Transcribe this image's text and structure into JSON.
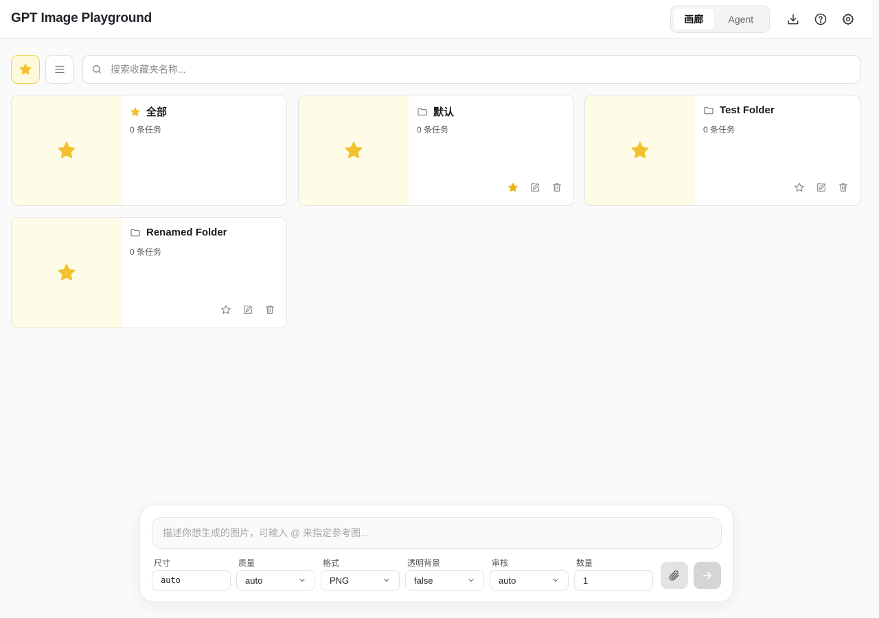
{
  "header": {
    "title": "GPT Image Playground",
    "tabs": [
      {
        "label": "画廊",
        "active": true
      },
      {
        "label": "Agent",
        "active": false
      }
    ],
    "icons": [
      "download-icon",
      "help-icon",
      "settings-icon"
    ]
  },
  "toolbar": {
    "search_placeholder": "搜索收藏夹名称..."
  },
  "folders": [
    {
      "name": "全部",
      "count": "0 条任务",
      "icon": "star-icon",
      "favorited": null
    },
    {
      "name": "默认",
      "count": "0 条任务",
      "icon": "folder-icon",
      "favorited": true
    },
    {
      "name": "Test Folder",
      "count": "0 条任务",
      "icon": "folder-icon",
      "favorited": false
    },
    {
      "name": "Renamed Folder",
      "count": "0 条任务",
      "icon": "folder-icon",
      "favorited": false
    }
  ],
  "composer": {
    "prompt_placeholder": "描述你想生成的图片，可输入 @ 来指定参考图...",
    "params": [
      {
        "label": "尺寸",
        "value": "auto",
        "type": "input"
      },
      {
        "label": "质量",
        "value": "auto",
        "type": "select"
      },
      {
        "label": "格式",
        "value": "PNG",
        "type": "select"
      },
      {
        "label": "透明背景",
        "value": "false",
        "type": "select"
      },
      {
        "label": "审核",
        "value": "auto",
        "type": "select"
      },
      {
        "label": "数量",
        "value": "1",
        "type": "input"
      }
    ]
  },
  "colors": {
    "accent_star": "#f2c12e",
    "favorite_bg": "#fef9dc",
    "thumb_bg": "#fefbe6"
  }
}
